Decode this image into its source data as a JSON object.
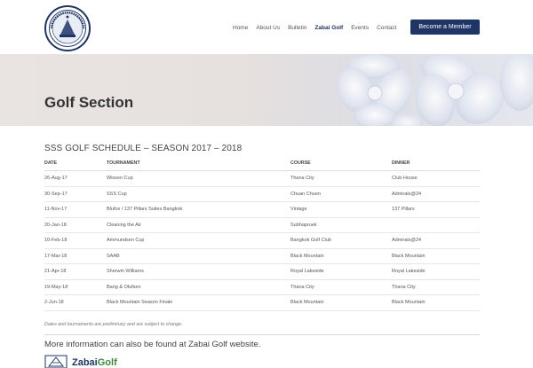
{
  "header": {
    "logo_icon": "club-seal-logo",
    "nav": [
      {
        "label": "Home",
        "active": false
      },
      {
        "label": "About Us",
        "active": false
      },
      {
        "label": "Bulletin",
        "active": false
      },
      {
        "label": "Zabai Golf",
        "active": true
      },
      {
        "label": "Events",
        "active": false
      },
      {
        "label": "Contact",
        "active": false
      }
    ],
    "cta_label": "Become a Member",
    "accent": "#1f3566"
  },
  "banner": {
    "title": "Golf Section",
    "image_icon": "orchid-flowers-image"
  },
  "schedule": {
    "title": "SSS GOLF SCHEDULE – SEASON 2017 – 2018",
    "columns": [
      "DATE",
      "TOURNAMENT",
      "COURSE",
      "DINNER"
    ],
    "rows": [
      [
        "26-Aug-17",
        "Wissen Cup",
        "Thana City",
        "Club House"
      ],
      [
        "30-Sep-17",
        "SSS Cup",
        "Chuan Chuen",
        "Admirals@24"
      ],
      [
        "11-Nov-17",
        "Blufox / 137 Pillars Suites Bangkok",
        "Vintage",
        "137 Pillars"
      ],
      [
        "20-Jan-18",
        "Cleaning the Air",
        "Subhapruek",
        ""
      ],
      [
        "10-Feb-18",
        "Ammundsen Cup",
        "Bangkok Golf Club",
        "Admirals@24"
      ],
      [
        "17-Mar-18",
        "SAAB",
        "Black Mountain",
        "Black Mountain"
      ],
      [
        "21-Apr-18",
        "Sherwin Williams",
        "Royal Lakeside",
        "Royal Lakeside"
      ],
      [
        "19-May-18",
        "Bang & Olufsen",
        "Thana City",
        "Thana City"
      ],
      [
        "2-Jun-18",
        "Black Mountain Season Finale",
        "Black Mountain",
        "Black Mountain"
      ]
    ],
    "note": "Dates and tournaments are preliminary and are subject to change."
  },
  "footer": {
    "more_info": "More information can also be found at Zabai Golf website.",
    "zabai_logo_text_1": "Zabai",
    "zabai_logo_text_2": "Golf"
  }
}
